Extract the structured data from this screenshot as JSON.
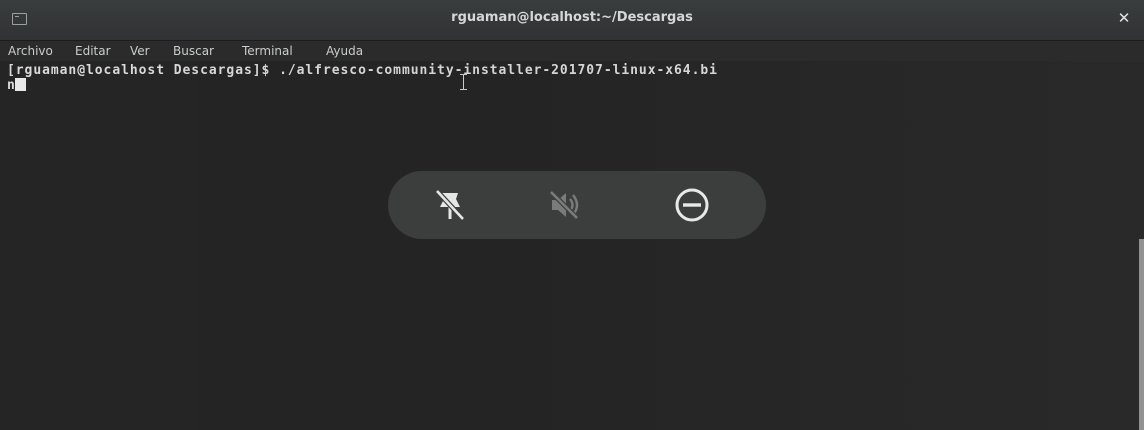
{
  "window": {
    "title": "rguaman@localhost:~/Descargas",
    "icon": "terminal-icon",
    "close_icon": "close-icon"
  },
  "menubar": {
    "items": [
      "Archivo",
      "Editar",
      "Ver",
      "Buscar",
      "Terminal",
      "Ayuda"
    ]
  },
  "terminal": {
    "line1": "[rguaman@localhost Descargas]$ ./alfresco-community-installer-201707-linux-x64.bi",
    "line2": "n"
  },
  "osd": {
    "icons": [
      "notifications-disabled-icon",
      "volume-muted-icon",
      "do-not-disturb-icon"
    ]
  },
  "colors": {
    "terminal_bg": "#252525",
    "titlebar_bg": "#303233",
    "text": "#dadada",
    "osd_bg": "#3e4040"
  }
}
